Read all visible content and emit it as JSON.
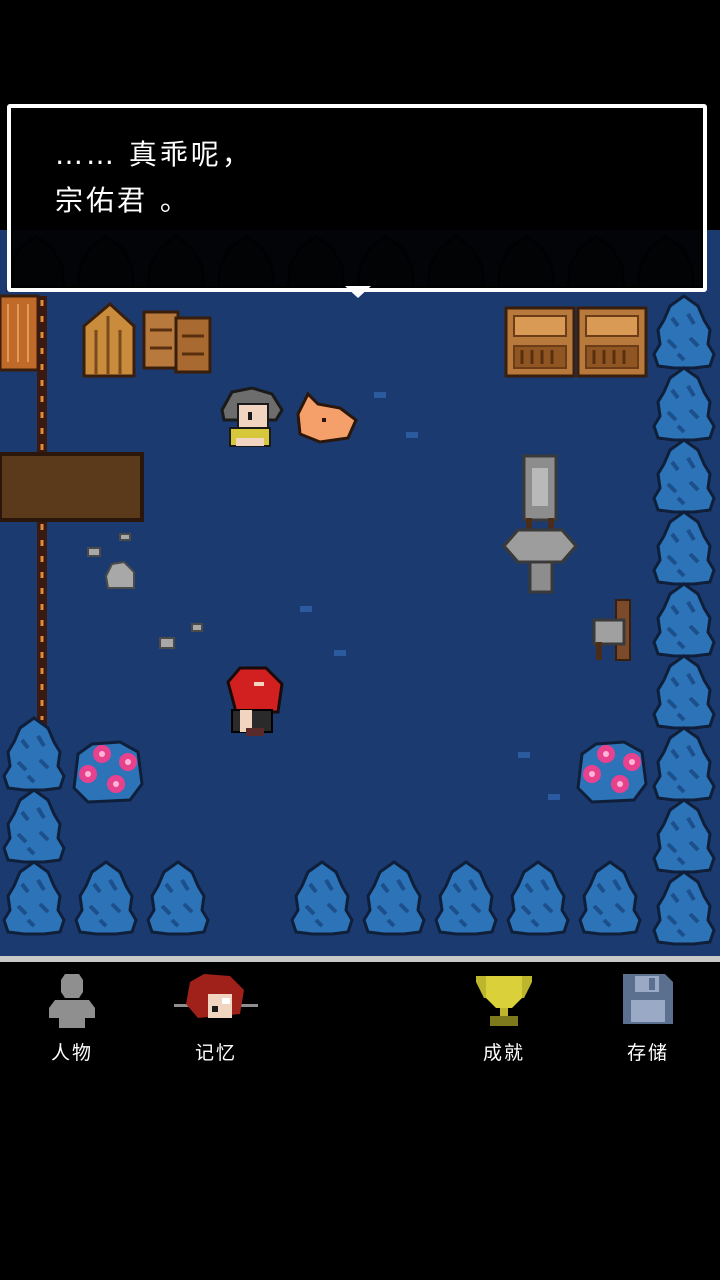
{
  "dialog": {
    "line1": "…… 真乖呢，",
    "line2": "宗佑君 。"
  },
  "menu": {
    "characters_label": "人物",
    "memory_label": "记忆",
    "achievements_label": "成就",
    "save_label": "存储"
  },
  "icons": {
    "characters": "person-silhouette-icon",
    "memory": "red-hair-portrait-icon",
    "achievements": "trophy-icon",
    "save": "floppy-disk-icon"
  },
  "colors": {
    "ground": "#1b3b70",
    "tree": "#2c73b8",
    "dialog_border": "#ffffff",
    "menu_text": "#ffffff",
    "trophy": "#bdb52c"
  }
}
